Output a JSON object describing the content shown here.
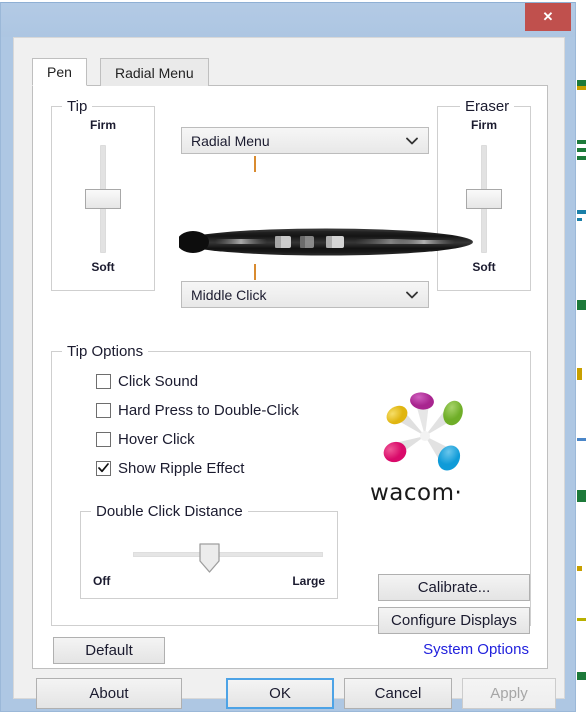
{
  "window": {
    "close_label": "✕"
  },
  "tabs": [
    {
      "label": "Pen",
      "active": true
    },
    {
      "label": "Radial Menu",
      "active": false
    }
  ],
  "tip_group": {
    "title": "Tip",
    "firm_label": "Firm",
    "soft_label": "Soft",
    "value_percent": 50
  },
  "eraser_group": {
    "title": "Eraser",
    "firm_label": "Firm",
    "soft_label": "Soft",
    "value_percent": 50
  },
  "pen_controls": {
    "top_dropdown_value": "Radial Menu",
    "bottom_dropdown_value": "Middle Click",
    "dropdown_icon": "chevron-down-icon"
  },
  "tip_options": {
    "title": "Tip Options",
    "items": [
      {
        "label": "Click Sound",
        "checked": false
      },
      {
        "label": "Hard Press to Double-Click",
        "checked": false
      },
      {
        "label": "Hover Click",
        "checked": false
      },
      {
        "label": "Show Ripple Effect",
        "checked": true
      }
    ]
  },
  "double_click_distance": {
    "title": "Double Click Distance",
    "min_label": "Off",
    "max_label": "Large",
    "value_percent": 50
  },
  "brand": {
    "wordmark": "wacom·",
    "logo_icon": "wacom-pinwheel-logo",
    "colors": {
      "yellow": "#edc01f",
      "magenta": "#b8309e",
      "green": "#7cbb33",
      "pink": "#e3157a",
      "blue": "#25a8e0"
    }
  },
  "side_buttons": {
    "calibrate": "Calibrate...",
    "configure_displays": "Configure Displays"
  },
  "footer_row": {
    "default_label": "Default",
    "system_options_label": "System Options",
    "system_options_color": "#2222dd"
  },
  "dialog_buttons": {
    "about": "About",
    "ok": "OK",
    "cancel": "Cancel",
    "apply": "Apply",
    "ok_focused": true,
    "apply_disabled": true
  },
  "theme": {
    "titlebar": "#aec7e3",
    "close_button": "#c0504d",
    "client_bg": "#f0f0f0",
    "page_bg": "#ffffff",
    "connector": "#d98b30"
  }
}
